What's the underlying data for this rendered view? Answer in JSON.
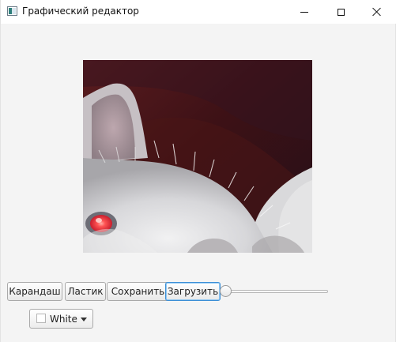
{
  "window": {
    "title": "Графический редактор",
    "icons": {
      "app": "app-icon",
      "minimize": "minimize-icon",
      "maximize": "maximize-icon",
      "close": "close-icon"
    }
  },
  "canvas": {
    "image_description_hint": "cat-photo",
    "eye_color": "#ff4b4b"
  },
  "toolbar": {
    "buttons": [
      {
        "label": "Карандаш"
      },
      {
        "label": "Ластик"
      },
      {
        "label": "Сохранить"
      },
      {
        "label": "Загрузить"
      }
    ],
    "slider_value": 0
  },
  "color_picker": {
    "selected": "White",
    "swatch_color": "#ffffff"
  }
}
